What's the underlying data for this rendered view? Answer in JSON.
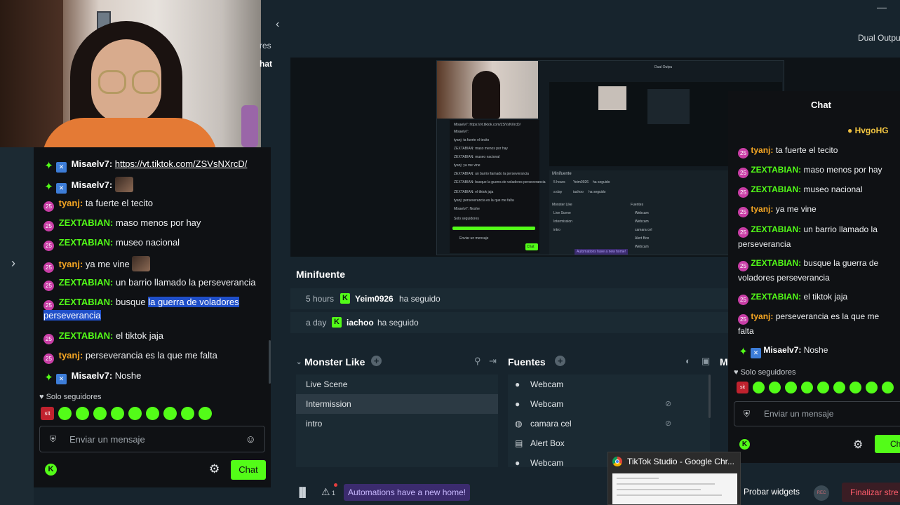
{
  "left_chat": {
    "messages": [
      {
        "badges": [
          "green",
          "blue"
        ],
        "user": "Misaelv7:",
        "user_color": "white",
        "text": "https://vt.tiktok.com/ZSVsNXrcD/",
        "link": true
      },
      {
        "badges": [
          "green",
          "blue"
        ],
        "user": "Misaelv7:",
        "user_color": "white",
        "text": "",
        "emote": true
      },
      {
        "badges": [
          "pink"
        ],
        "user": "tyanj:",
        "user_color": "orange",
        "text": "ta fuerte el tecito"
      },
      {
        "badges": [
          "pink"
        ],
        "user": "ZEXTABIAN:",
        "user_color": "green",
        "text": "maso menos por hay"
      },
      {
        "badges": [
          "pink"
        ],
        "user": "ZEXTABIAN:",
        "user_color": "green",
        "text": "museo nacional"
      },
      {
        "badges": [
          "pink"
        ],
        "user": "tyanj:",
        "user_color": "orange",
        "text": "ya me vine",
        "emote": true
      },
      {
        "badges": [
          "pink"
        ],
        "user": "ZEXTABIAN:",
        "user_color": "green",
        "text": "un barrio llamado la perseverancia"
      },
      {
        "badges": [
          "pink"
        ],
        "user": "ZEXTABIAN:",
        "user_color": "green",
        "text": "busque ",
        "selected": "la guerra de voladores",
        "wrap": "perseverancia"
      },
      {
        "badges": [
          "pink"
        ],
        "user": "ZEXTABIAN:",
        "user_color": "green",
        "text": "el tiktok jaja"
      },
      {
        "badges": [
          "pink"
        ],
        "user": "tyanj:",
        "user_color": "orange",
        "text": "perseverancia es la que me falta"
      },
      {
        "badges": [
          "green",
          "blue"
        ],
        "user": "Misaelv7:",
        "user_color": "white",
        "text": "Noshe"
      }
    ],
    "followers_only": "Solo seguidores",
    "input_placeholder": "Enviar un mensaje",
    "chat_button": "Chat",
    "badge_sit": "sit"
  },
  "header": {
    "panel_stub_1": "res",
    "panel_stub_2": "hat",
    "dual_output": "Dual Outpu"
  },
  "right_chat": {
    "title": "Chat",
    "pinned_user": "HvgoHG",
    "messages": [
      {
        "user": "tyanj:",
        "user_color": "orange",
        "text": "ta fuerte el tecito"
      },
      {
        "user": "ZEXTABIAN:",
        "user_color": "green",
        "text": "maso menos por hay"
      },
      {
        "user": "ZEXTABIAN:",
        "user_color": "green",
        "text": "museo nacional"
      },
      {
        "user": "tyanj:",
        "user_color": "orange",
        "text": "ya me vine"
      },
      {
        "user": "ZEXTABIAN:",
        "user_color": "green",
        "text": "un barrio llamado la perseverancia"
      },
      {
        "user": "ZEXTABIAN:",
        "user_color": "green",
        "text": "busque la guerra de voladores perseverancia"
      },
      {
        "user": "ZEXTABIAN:",
        "user_color": "green",
        "text": "el tiktok jaja"
      },
      {
        "user": "tyanj:",
        "user_color": "orange",
        "text": "perseverancia es la que me falta"
      },
      {
        "user": "Misaelv7:",
        "user_color": "white",
        "text": "Noshe"
      }
    ],
    "followers_only": "Solo seguidores",
    "input_placeholder": "Enviar un mensaje",
    "chat_button": "Chat",
    "badge_sit": "sit"
  },
  "nested_preview": {
    "dual_output": "Dual Outpu",
    "minifuente": "Minifuente",
    "monster_like": "Monster Like",
    "fuentes": "Fuentes",
    "automations": "Automations have a new home!",
    "events": [
      {
        "time": "5 hours",
        "user": "Yeim0926",
        "action": "ha seguido"
      },
      {
        "time": "a day",
        "user": "iachoo",
        "action": "ha seguido"
      }
    ],
    "scenes": [
      "Live Scene",
      "Intermission",
      "intro"
    ],
    "sources": [
      "Webcam",
      "Webcam",
      "camara cel",
      "Alert Box",
      "Webcam"
    ],
    "chat_lines": [
      "Misaelv7: https://vt.tiktok.com/ZSVsNXrcD/",
      "Misaelv7:",
      "tyanj: ta fuerte el tecito",
      "ZEXTABIAN: maso menos por hay",
      "ZEXTABIAN: museo nacional",
      "tyanj: ya me vine",
      "ZEXTABIAN: un barrio llamado la perseverancia",
      "ZEXTABIAN: busque la guerra de voladores perseverancia",
      "ZEXTABIAN: el tiktok jaja",
      "tyanj: perseverancia es la que me falta",
      "Misaelv7: Noshe"
    ],
    "followers_only": "Solo seguidores",
    "input_placeholder": "Enviar un mensaje",
    "chat_button": "Chat"
  },
  "minifuente": {
    "title": "Minifuente",
    "events": [
      {
        "time": "5 hours",
        "user": "Yeim0926",
        "action": "ha seguido"
      },
      {
        "time": "a day",
        "user": "iachoo",
        "action": "ha seguido"
      }
    ]
  },
  "scenes": {
    "title": "Monster Like",
    "items": [
      "Live Scene",
      "Intermission",
      "intro"
    ],
    "active_index": 1
  },
  "sources": {
    "title": "Fuentes",
    "items": [
      {
        "icon": "user-icon",
        "label": "Webcam"
      },
      {
        "icon": "user-icon",
        "label": "Webcam"
      },
      {
        "icon": "globe-icon",
        "label": "camara cel"
      },
      {
        "icon": "widget-icon",
        "label": "Alert Box"
      },
      {
        "icon": "user-icon",
        "label": "Webcam"
      }
    ],
    "m_stub": "M"
  },
  "bottom_bar": {
    "alert_count": "1",
    "automations": "Automations have a new home!",
    "probar_widgets": "Probar widgets",
    "rec_label": "REC",
    "finalizar": "Finalizar stre"
  },
  "taskbar_popup": {
    "title": "TikTok Studio - Google Chr..."
  },
  "colors": {
    "kick_green": "#53fc18",
    "accent_purple": "#3b2b6e",
    "panel_dark": "#17242d",
    "chat_bg": "#0f1114"
  }
}
